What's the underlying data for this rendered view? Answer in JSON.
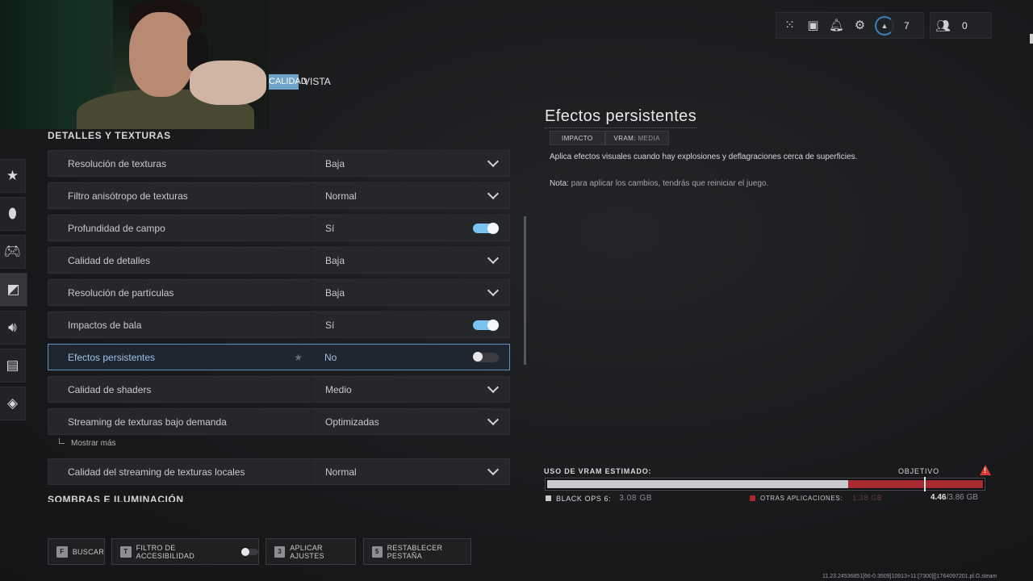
{
  "tabs": {
    "active_label": "CALIDAD",
    "next_label": "VISTA"
  },
  "hud": {
    "level": "7",
    "party_count": "0"
  },
  "sidebar_icons": [
    "star-icon",
    "mouse-icon",
    "controller-icon",
    "graphics-icon",
    "audio-icon",
    "interface-icon",
    "network-icon"
  ],
  "section": {
    "title": "DETALLES Y TEXTURAS",
    "next_title": "SOMBRAS E ILUMINACIÓN"
  },
  "settings": [
    {
      "label": "Resolución de texturas",
      "value": "Baja",
      "control": "dropdown"
    },
    {
      "label": "Filtro anisótropo de texturas",
      "value": "Normal",
      "control": "dropdown"
    },
    {
      "label": "Profundidad de campo",
      "value": "Sí",
      "control": "toggle-on"
    },
    {
      "label": "Calidad de detalles",
      "value": "Baja",
      "control": "dropdown"
    },
    {
      "label": "Resolución de partículas",
      "value": "Baja",
      "control": "dropdown"
    },
    {
      "label": "Impactos de bala",
      "value": "Sí",
      "control": "toggle-on"
    },
    {
      "label": "Efectos persistentes",
      "value": "No",
      "control": "toggle-off",
      "selected": true
    },
    {
      "label": "Calidad de shaders",
      "value": "Medio",
      "control": "dropdown"
    },
    {
      "label": "Streaming de texturas bajo demanda",
      "value": "Optimizadas",
      "control": "dropdown"
    },
    {
      "label": "Calidad del streaming de texturas locales",
      "value": "Normal",
      "control": "dropdown"
    }
  ],
  "show_more": "Mostrar más",
  "detail": {
    "title": "Efectos persistentes",
    "tag_impact": "IMPACTO",
    "tag_vram_key": "VRAM:",
    "tag_vram_value": "MEDIA",
    "description": "Aplica efectos visuales cuando hay explosiones y deflagraciones cerca de superficies.",
    "note_label": "Nota:",
    "note_text": " para aplicar los cambios, tendrás que reiniciar el juego."
  },
  "vram": {
    "label": "USO DE VRAM ESTIMADO:",
    "target_label": "OBJETIVO",
    "game_label": "BLACK OPS 6:",
    "game_value": "3.08 GB",
    "game_gb": 3.08,
    "other_label": "OTRAS APLICACIONES:",
    "other_value": "1.38 GB",
    "other_gb": 1.38,
    "total_used": "4.46",
    "total_available": "/3.86 GB",
    "available_gb": 3.86
  },
  "bottom_buttons": [
    {
      "key": "F",
      "label": "BUSCAR"
    },
    {
      "key": "T",
      "label": "FILTRO DE ACCESIBILIDAD"
    },
    {
      "key": "3",
      "label": "APLICAR AJUSTES"
    },
    {
      "key": "5",
      "label": "RESTABLECER PESTAÑA"
    }
  ],
  "build_string": "11.23.24536851[66-0.3509]10913+11:[7300][]1764097201.pl.G.steam"
}
